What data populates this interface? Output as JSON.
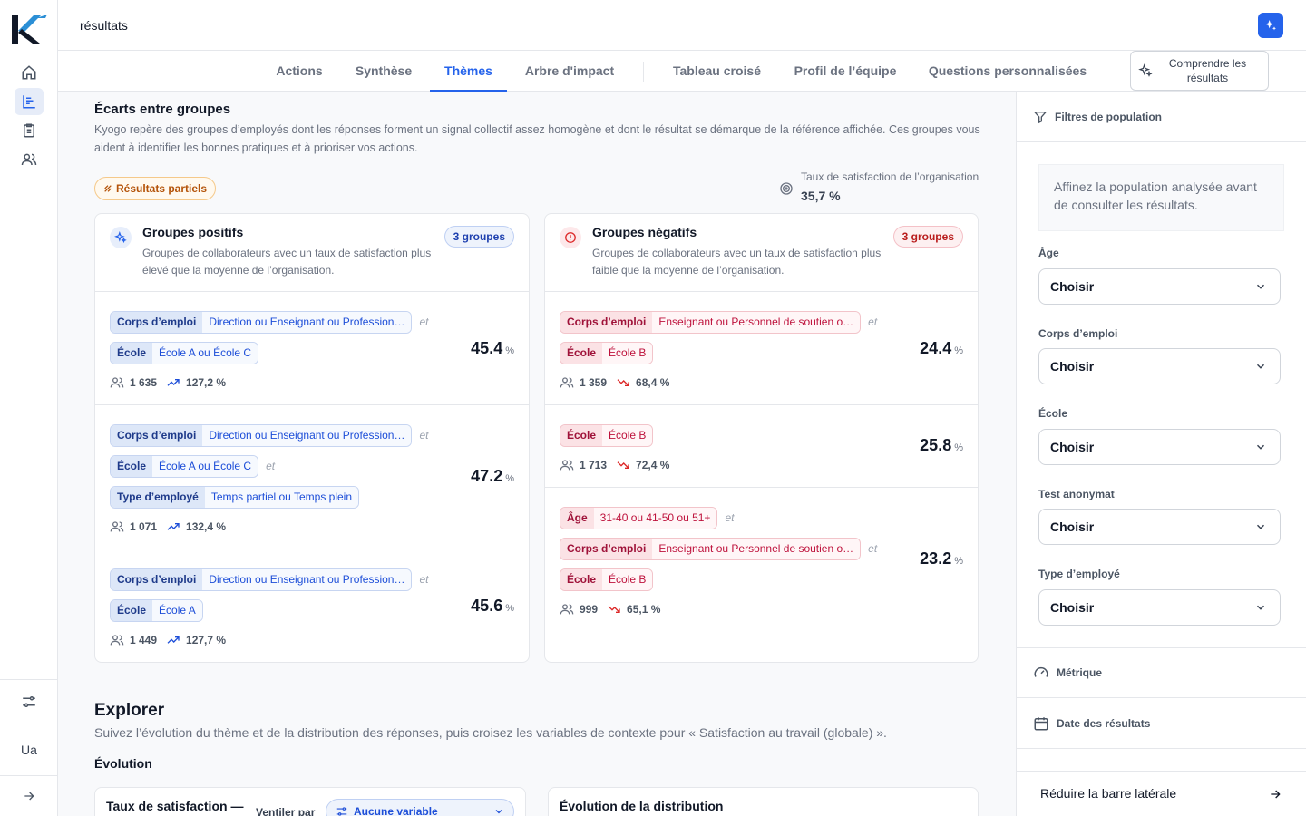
{
  "app": {
    "title": "résultats",
    "user_initials": "Ua"
  },
  "tabs": [
    {
      "label": "Actions"
    },
    {
      "label": "Synthèse"
    },
    {
      "label": "Thèmes"
    },
    {
      "label": "Arbre d'impact"
    },
    {
      "label": "Tableau croisé"
    },
    {
      "label": "Profil de l’équipe"
    },
    {
      "label": "Questions personnalisées"
    }
  ],
  "understand_button": "Comprendre les résultats",
  "section": {
    "title": "Écarts entre groupes",
    "description": "Kyogo repère des groupes d’employés dont les réponses forment un signal collectif assez homogène et dont le résultat se démarque de la référence affichée. Ces groupes vous aident à identifier les bonnes pratiques et à prioriser vos actions.",
    "partial_badge": "Résultats partiels",
    "org_label": "Taux de satisfaction de l’organisation",
    "org_value": "35,7 %"
  },
  "positive": {
    "title": "Groupes positifs",
    "description": "Groupes de collaborateurs avec un taux de satisfaction plus élevé que la moyenne de l’organisation.",
    "count": "3 groupes",
    "groups": [
      {
        "tags": [
          {
            "k": "Corps d’emploi",
            "v": "Direction ou Enseignant ou Profession…"
          },
          {
            "k": "École",
            "v": "École A ou École C"
          }
        ],
        "score": "45.4",
        "n": "1 635",
        "pct": "127,2 %"
      },
      {
        "tags": [
          {
            "k": "Corps d’emploi",
            "v": "Direction ou Enseignant ou Profession…"
          },
          {
            "k": "École",
            "v": "École A ou École C"
          },
          {
            "k": "Type d’employé",
            "v": "Temps partiel ou Temps plein"
          }
        ],
        "score": "47.2",
        "n": "1 071",
        "pct": "132,4 %"
      },
      {
        "tags": [
          {
            "k": "Corps d’emploi",
            "v": "Direction ou Enseignant ou Profession…"
          },
          {
            "k": "École",
            "v": "École A"
          }
        ],
        "score": "45.6",
        "n": "1 449",
        "pct": "127,7 %"
      }
    ]
  },
  "negative": {
    "title": "Groupes négatifs",
    "description": "Groupes de collaborateurs avec un taux de satisfaction plus faible que la moyenne de l’organisation.",
    "count": "3 groupes",
    "groups": [
      {
        "tags": [
          {
            "k": "Corps d’emploi",
            "v": "Enseignant ou Personnel de soutien o…"
          },
          {
            "k": "École",
            "v": "École B"
          }
        ],
        "score": "24.4",
        "n": "1 359",
        "pct": "68,4 %"
      },
      {
        "tags": [
          {
            "k": "École",
            "v": "École B"
          }
        ],
        "score": "25.8",
        "n": "1 713",
        "pct": "72,4 %"
      },
      {
        "tags": [
          {
            "k": "Âge",
            "v": "31-40 ou 41-50 ou 51+"
          },
          {
            "k": "Corps d’emploi",
            "v": "Enseignant ou Personnel de soutien o…"
          },
          {
            "k": "École",
            "v": "École B"
          }
        ],
        "score": "23.2",
        "n": "999",
        "pct": "65,1 %"
      }
    ]
  },
  "et": "et",
  "percent": "%",
  "explorer": {
    "title": "Explorer",
    "description": "Suivez l’évolution du thème et de la distribution des réponses, puis croisez les variables de contexte pour « Satisfaction au travail (globale) ».",
    "evolution": "Évolution",
    "panel1_title": "Taux de satisfaction —",
    "ventiler": "Ventiler par",
    "variable": "Aucune variable",
    "panel2_title": "Évolution de la distribution"
  },
  "sidebar": {
    "filters_title": "Filtres de population",
    "note": "Affinez la population analysée avant de consulter les résultats.",
    "filters": [
      {
        "label": "Âge",
        "value": "Choisir"
      },
      {
        "label": "Corps d’emploi",
        "value": "Choisir"
      },
      {
        "label": "École",
        "value": "Choisir"
      },
      {
        "label": "Test anonymat",
        "value": "Choisir"
      },
      {
        "label": "Type d’employé",
        "value": "Choisir"
      }
    ],
    "metric": "Métrique",
    "date": "Date des résultats",
    "collapse": "Réduire la barre latérale"
  }
}
